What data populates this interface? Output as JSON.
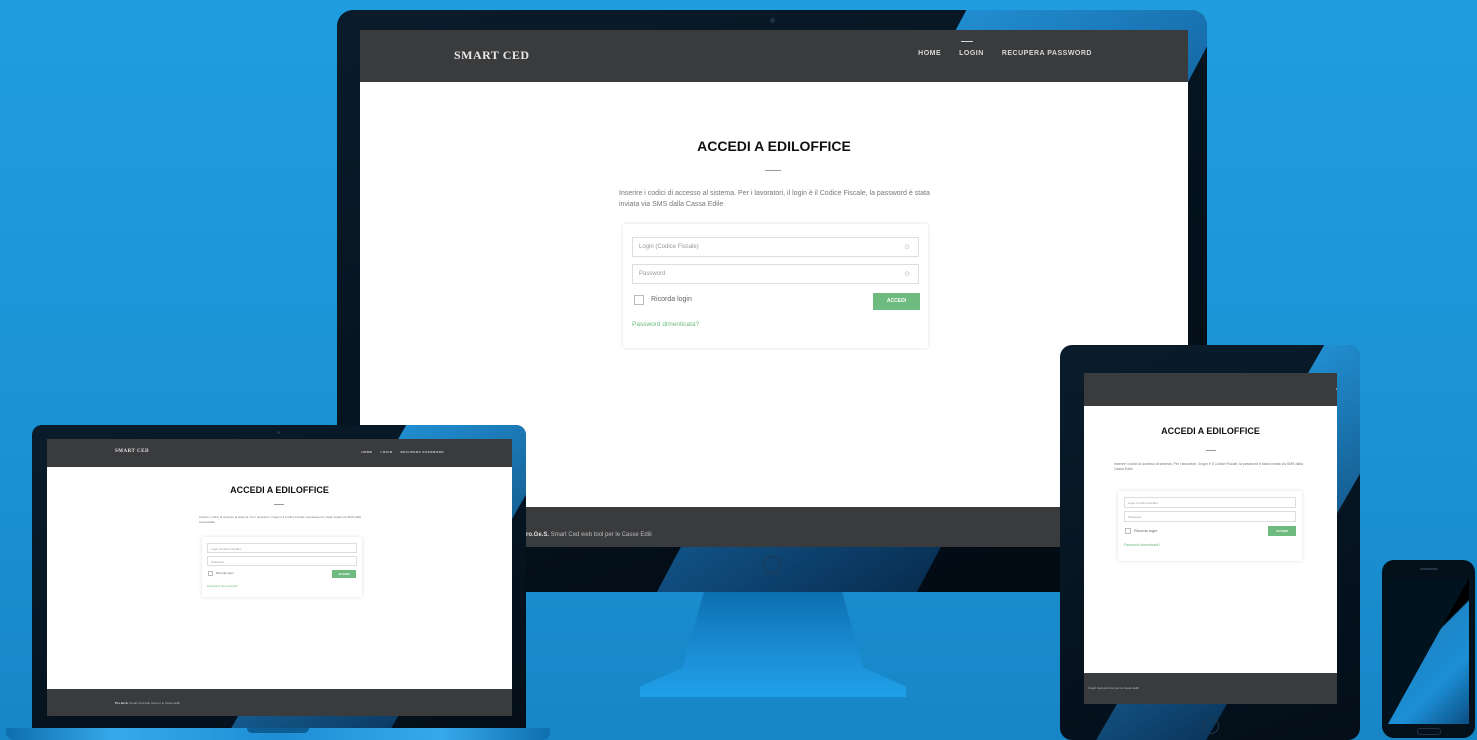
{
  "site": {
    "brand": "SMART CED",
    "nav": [
      "HOME",
      "LOGIN",
      "RECUPERA PASSWORD"
    ],
    "title": "ACCEDI A EDILOFFICE",
    "intro": "Inserire i codici di accesso al sistema. Per i lavoratori, il login è il Codice Fiscale, la password è stata inviata via SMS dalla Cassa Edile",
    "login_placeholder": "Login (Codice Fiscale)",
    "password_placeholder": "Password",
    "remember_label": "Ricorda login",
    "submit_label": "ACCEDI",
    "forgot_label": "Password dimenticata?",
    "footer_brand": "Pro.Ge.S.",
    "footer_text": "Smart Ced web tool per le Casse Edili"
  },
  "colors": {
    "background": "#1f9ddf",
    "nav": "#3a3b3d",
    "accent_green": "#6dbb7e"
  }
}
